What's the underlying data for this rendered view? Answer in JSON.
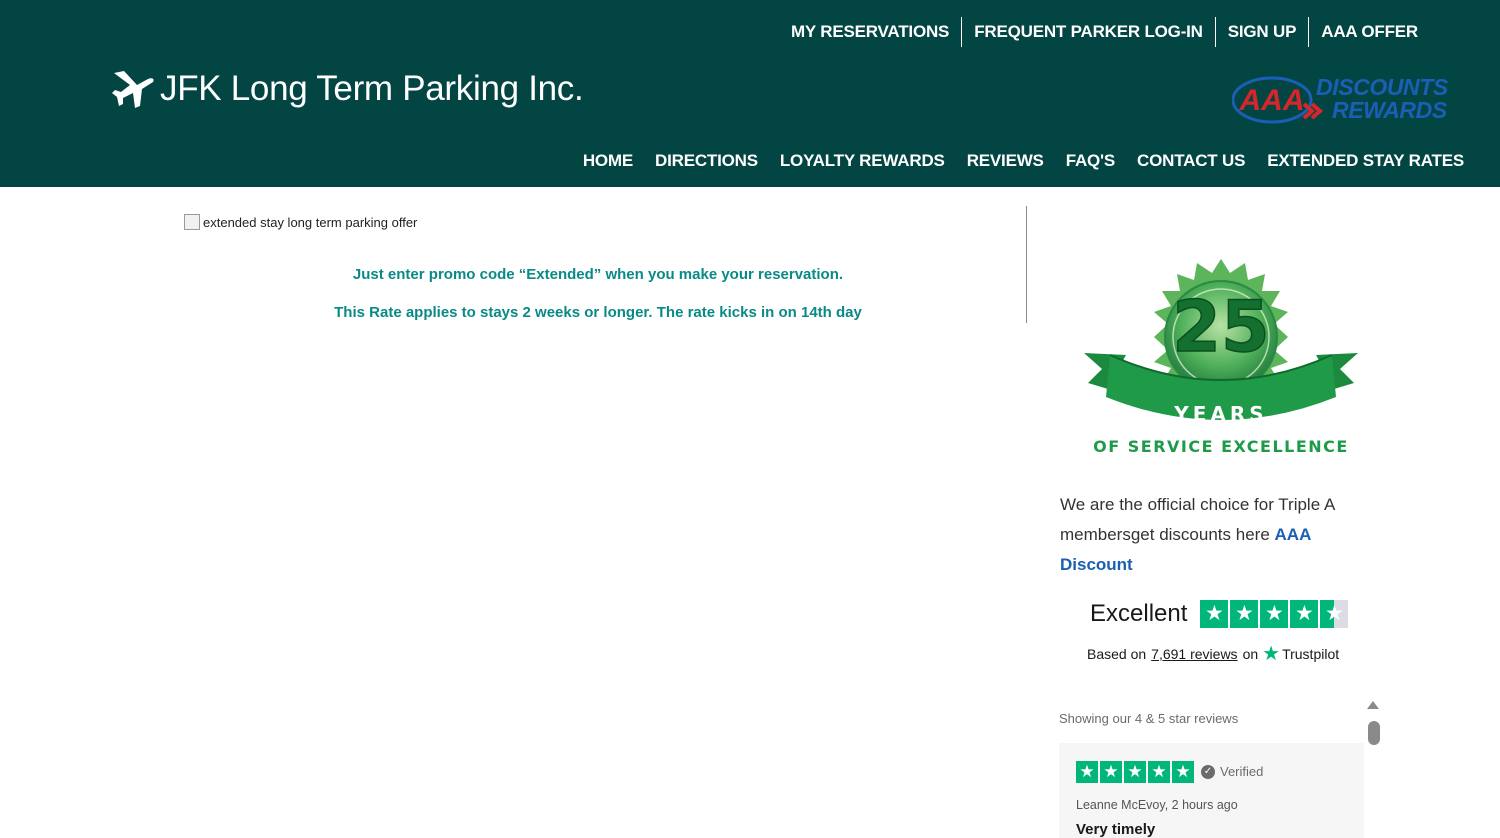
{
  "header": {
    "top_links": [
      "MY RESERVATIONS",
      "FREQUENT PARKER LOG-IN",
      "SIGN UP",
      "AAA OFFER"
    ],
    "logo_text": "JFK Long Term Parking Inc.",
    "aaa_logo": {
      "brand": "AAA",
      "line1": "DISCOUNTS",
      "line2": "REWARDS"
    },
    "main_nav": [
      "HOME",
      "DIRECTIONS",
      "LOYALTY REWARDS",
      "REVIEWS",
      "FAQ'S",
      "CONTACT US",
      "EXTENDED STAY RATES"
    ]
  },
  "content": {
    "image_alt": "extended stay long term parking offer",
    "promo_line1": "Just enter promo code “Extended” when you make your reservation.",
    "promo_line2": "This Rate applies to stays 2 weeks or longer. The rate kicks in on 14th day"
  },
  "sidebar": {
    "badge": {
      "number": "25",
      "years": "YEARS",
      "caption": "OF SERVICE EXCELLENCE"
    },
    "choice_text": "We are the official choice for Triple A membersget discounts here",
    "choice_link": "AAA Discount",
    "trustpilot": {
      "rating_text": "Excellent",
      "stars": 4.5,
      "based_on": "Based on",
      "reviews_link": "7,691 reviews",
      "on": "on",
      "brand": "Trustpilot"
    },
    "showing_text": "Showing our 4 & 5 star reviews",
    "review": {
      "stars": 5,
      "verified": "Verified",
      "author": "Leanne McEvoy, 2 hours ago",
      "title": "Very timely"
    }
  },
  "colors": {
    "header_bg": "#034543",
    "promo": "#0a8a86",
    "trustpilot_green": "#00b67a",
    "link_blue": "#1a5fb4"
  }
}
